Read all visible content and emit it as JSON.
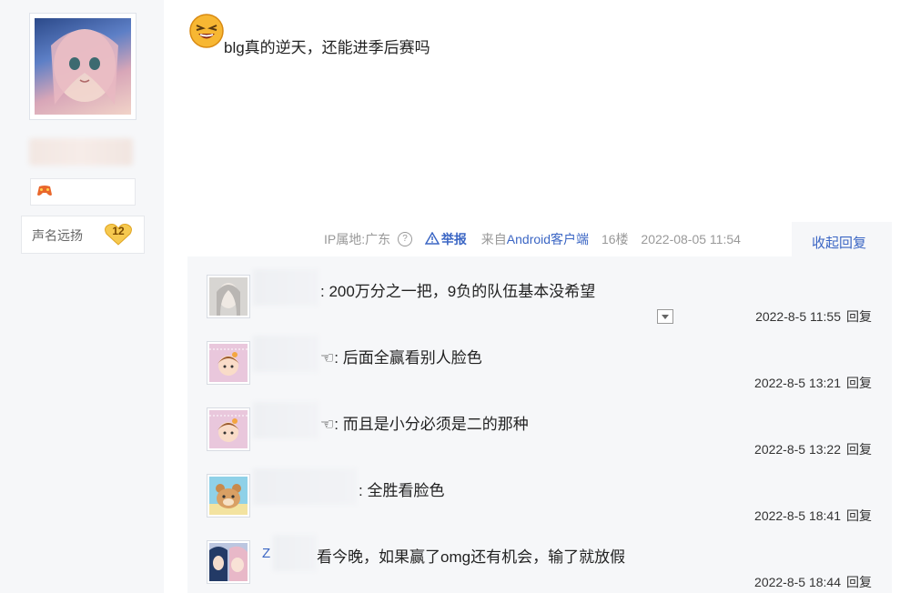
{
  "author": {
    "avatar": "anime-girl-avatar",
    "badge_icon": "game-controller-icon",
    "reputation_label": "声名远扬",
    "reputation_level": "12"
  },
  "post": {
    "emoji": "laughing-face-emoji",
    "text": "blg真的逆天，还能进季后赛吗",
    "meta": {
      "ip_location": "IP属地:广东",
      "help_icon": "?",
      "report_label": "举报",
      "source_prefix": "来自",
      "source_client": "Android客户端",
      "floor": "16楼",
      "datetime": "2022-08-05 11:54"
    },
    "collapse_label": "收起回复"
  },
  "replies": [
    {
      "name_prefix": "",
      "name_suffix": "",
      "text": ": 200万分之一把，9负的队伍基本没希望",
      "time": "2022-8-5 11:55",
      "reply_label": "回复",
      "has_dropdown": true
    },
    {
      "name_prefix": "",
      "name_suffix": "☜",
      "text": ": 后面全赢看别人脸色",
      "time": "2022-8-5 13:21",
      "reply_label": "回复"
    },
    {
      "name_prefix": "",
      "name_suffix": "☜",
      "text": ": 而且是小分必须是二的那种",
      "time": "2022-8-5 13:22",
      "reply_label": "回复"
    },
    {
      "name_prefix": "",
      "name_suffix": "",
      "text": ": 全胜看脸色",
      "time": "2022-8-5 18:41",
      "reply_label": "回复"
    },
    {
      "name_prefix": "Z",
      "name_suffix": "",
      "text": "看今晚，如果赢了omg还有机会，输了就放假",
      "time": "2022-8-5 18:44",
      "reply_label": "回复"
    }
  ]
}
